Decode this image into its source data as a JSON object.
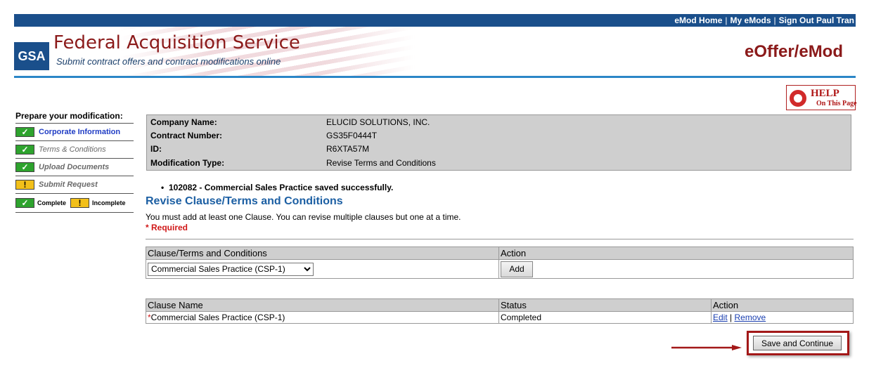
{
  "topnav": {
    "home": "eMod Home",
    "my_emods": "My eMods",
    "sign_out": "Sign Out Paul Tran",
    "sep": "|"
  },
  "banner": {
    "logo": "GSA",
    "org": "Federal Acquisition Service",
    "tagline": "Submit contract offers and contract modifications online",
    "app": "eOffer/eMod"
  },
  "help": {
    "line1": "HELP",
    "line2": "On This Page"
  },
  "sidebar": {
    "title": "Prepare your modification:",
    "items": [
      {
        "label": "Corporate Information",
        "status": "complete"
      },
      {
        "label": "Terms & Conditions",
        "status": "complete"
      },
      {
        "label": "Upload Documents",
        "status": "complete"
      },
      {
        "label": "Submit Request",
        "status": "incomplete"
      }
    ],
    "legend": {
      "complete": "Complete",
      "incomplete": "Incomplete"
    },
    "glyph_check": "✓",
    "glyph_warn": "!"
  },
  "info": {
    "company_name_label": "Company Name:",
    "company_name": "ELUCID SOLUTIONS, INC.",
    "contract_number_label": "Contract Number:",
    "contract_number": "GS35F0444T",
    "id_label": "ID:",
    "id": "R6XTA57M",
    "mod_type_label": "Modification Type:",
    "mod_type": "Revise Terms and Conditions"
  },
  "message": "102082 - Commercial Sales Practice saved successfully.",
  "section": {
    "title": "Revise Clause/Terms and Conditions",
    "instructions": "You must add at least one Clause. You can revise multiple clauses but one at a time.",
    "required": "* Required"
  },
  "add_table": {
    "headers": [
      "Clause/Terms and Conditions",
      "Action"
    ],
    "selected": "Commercial Sales Practice (CSP-1)",
    "add_label": "Add"
  },
  "clause_table": {
    "headers": [
      "Clause Name",
      "Status",
      "Action"
    ],
    "rows": [
      {
        "star": "*",
        "name": "Commercial Sales Practice (CSP-1)",
        "status": "Completed",
        "edit": "Edit",
        "remove": "Remove"
      }
    ]
  },
  "save_label": "Save and Continue",
  "colors": {
    "navy": "#1a4f8b",
    "maroon": "#8b1a1a",
    "link": "#1a3fb0",
    "check": "#2ea32e",
    "warn": "#f2c01a",
    "required": "#d01818"
  }
}
